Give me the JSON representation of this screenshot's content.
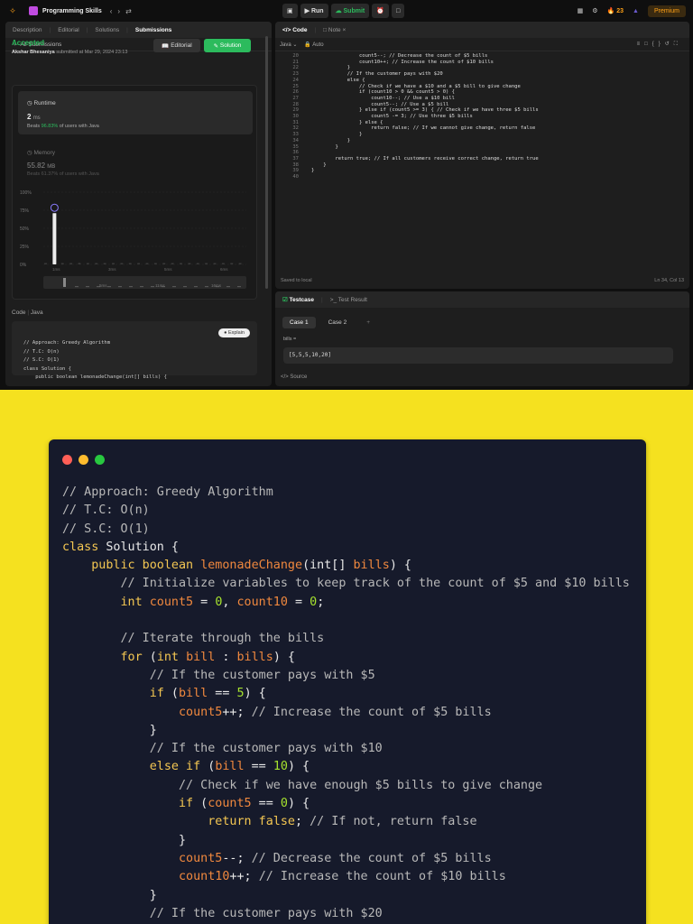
{
  "topbar": {
    "problem_list": "Programming Skills",
    "run": "Run",
    "submit": "Submit",
    "streak": "23",
    "premium": "Premium"
  },
  "left_panel": {
    "tabs": [
      "Description",
      "Editorial",
      "Solutions",
      "Submissions"
    ],
    "back": "All Submissions",
    "status": "Accepted",
    "submitter": "Akshar Bhesaniya",
    "submitted_at": "submitted at Mar 29, 2024 23:13",
    "editorial_btn": "Editorial",
    "solution_btn": "Solution",
    "runtime_label": "Runtime",
    "runtime_value": "2",
    "runtime_unit": "ms",
    "runtime_beats_prefix": "Beats",
    "runtime_beats": "96.83%",
    "runtime_beats_suffix": "of users with Java",
    "memory_label": "Memory",
    "memory_value": "55.82",
    "memory_unit": "MB",
    "memory_beats": "Beats 61.37% of users with Java",
    "code_label": "Code",
    "code_lang": "Java",
    "explain": "Explain",
    "mini_code": "// Approach: Greedy Algorithm\n// T.C: O(n)\n// S.C: O(1)\nclass Solution {\n    public boolean lemonadeChange(int[] bills) {"
  },
  "chart_data": {
    "type": "bar",
    "y_ticks": [
      "100%",
      "75%",
      "50%",
      "25%",
      "0%"
    ],
    "x_ticks": [
      "1ms",
      "3ms",
      "5ms",
      "6ms"
    ],
    "overview_ticks": [
      "5ms",
      "11ms",
      "16ms"
    ],
    "ylim": [
      0,
      100
    ],
    "values": [
      0,
      71,
      0,
      0,
      2,
      1,
      1,
      1,
      1,
      1,
      1,
      0,
      1,
      1,
      1,
      1,
      1,
      1,
      1,
      1,
      1,
      1,
      1,
      1
    ],
    "highlight_index": 1
  },
  "editor": {
    "tabs": [
      "Code",
      "Note"
    ],
    "lang": "Java",
    "mode": "Auto",
    "start_line": 20,
    "code": "                count5--; // Decrease the count of $5 bills\n                count10++; // Increase the count of $10 bills\n            }\n            // If the customer pays with $20\n            else {\n                // Check if we have a $10 and a $5 bill to give change\n                if (count10 > 0 && count5 > 0) {\n                    count10--; // Use a $10 bill\n                    count5--; // Use a $5 bill\n                } else if (count5 >= 3) { // Check if we have three $5 bills\n                    count5 -= 3; // Use three $5 bills\n                } else {\n                    return false; // If we cannot give change, return false\n                }\n            }\n        }\n\n        return true; // If all customers receive correct change, return true\n    }\n}\n",
    "saved": "Saved to local",
    "position": "Ln 34, Col 13"
  },
  "testcase": {
    "tabs": [
      "Testcase",
      "Test Result"
    ],
    "cases": [
      "Case 1",
      "Case 2"
    ],
    "label": "bills =",
    "value": "[5,5,5,10,20]",
    "source": "Source"
  },
  "card": {
    "dot_colors": [
      "#ff5f57",
      "#febc2e",
      "#28c840"
    ]
  }
}
